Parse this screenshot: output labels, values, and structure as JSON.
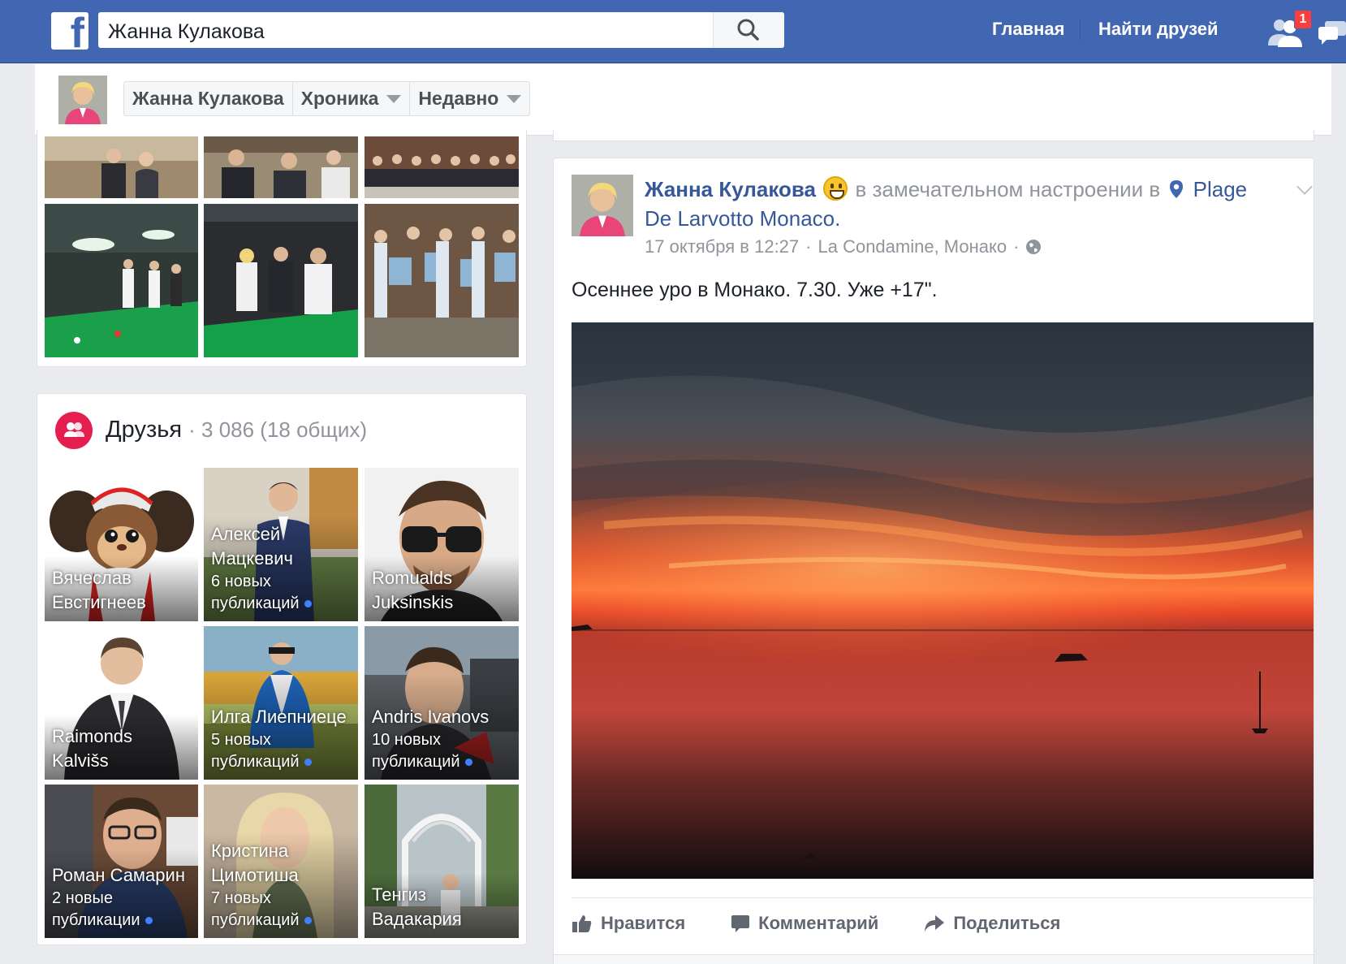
{
  "search": {
    "value": "Жанна Кулакова"
  },
  "nav": {
    "home": "Главная",
    "find_friends": "Найти друзей",
    "friend_requests_count": "1"
  },
  "profile_bar": {
    "name": "Жанна Кулакова",
    "timeline": "Хроника",
    "recent": "Недавно"
  },
  "friends": {
    "title": "Друзья",
    "count": "· 3 086 (18 общих)",
    "items": [
      {
        "name": "Вячеслав Евстигнеев",
        "sub": ""
      },
      {
        "name": "Алексей Мацкевич",
        "sub": "6 новых публикаций"
      },
      {
        "name": "Romualds Juksinskis",
        "sub": ""
      },
      {
        "name": "Raimonds Kalvišs",
        "sub": ""
      },
      {
        "name": "Илга Лиепниеце",
        "sub": "5 новых публикаций"
      },
      {
        "name": "Andris Ivanovs",
        "sub": "10 новых публикаций"
      },
      {
        "name": "Роман Самарин",
        "sub": "2 новые публикации"
      },
      {
        "name": "Кристина Цимотиша",
        "sub": "7 новых публикаций"
      },
      {
        "name": "Тенгиз Вадакария",
        "sub": ""
      }
    ]
  },
  "post": {
    "author": "Жанна Кулакова",
    "feeling": "в замечательном настроении в",
    "place": "Plage De Larvotto Monaco.",
    "date": "17 октября в 12:27",
    "location": "La Condamine, Монако",
    "text": "Осеннее уро в Монако. 7.30. Уже +17\".",
    "actions": {
      "like": "Нравится",
      "comment": "Комментарий",
      "share": "Поделиться"
    }
  },
  "colors": {
    "brand": "#4267b2",
    "link": "#365899",
    "meta": "#90949c",
    "friends_icon": "#e41e4f"
  }
}
